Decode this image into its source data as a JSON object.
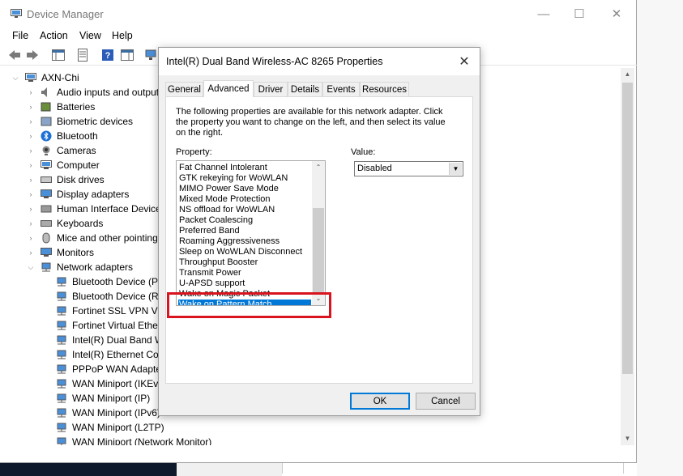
{
  "window": {
    "title": "Device Manager",
    "minimize": "—",
    "maximize": "☐",
    "close": "✕"
  },
  "menu": [
    "File",
    "Action",
    "View",
    "Help"
  ],
  "tree": {
    "root": "AXN-Chi",
    "categories": [
      {
        "label": "Audio inputs and outputs",
        "icon": "speaker-icon"
      },
      {
        "label": "Batteries",
        "icon": "battery-icon"
      },
      {
        "label": "Biometric devices",
        "icon": "biometric-icon"
      },
      {
        "label": "Bluetooth",
        "icon": "bluetooth-icon"
      },
      {
        "label": "Cameras",
        "icon": "camera-icon"
      },
      {
        "label": "Computer",
        "icon": "computer-icon"
      },
      {
        "label": "Disk drives",
        "icon": "disk-icon"
      },
      {
        "label": "Display adapters",
        "icon": "display-icon"
      },
      {
        "label": "Human Interface Devices",
        "icon": "hid-icon"
      },
      {
        "label": "Keyboards",
        "icon": "keyboard-icon"
      },
      {
        "label": "Mice and other pointing devices",
        "icon": "mouse-icon"
      },
      {
        "label": "Monitors",
        "icon": "monitor-icon"
      },
      {
        "label": "Network adapters",
        "icon": "network-icon"
      }
    ],
    "network_children": [
      "Bluetooth Device (Personal Area Network)",
      "Bluetooth Device (RFCOMM Protocol TDI)",
      "Fortinet SSL VPN Virtual Ethernet Adapter",
      "Fortinet Virtual Ethernet Adapter",
      "Intel(R) Dual Band Wireless-AC 8265",
      "Intel(R) Ethernet Connection",
      "PPPoP WAN Adapter",
      "WAN Miniport (IKEv2)",
      "WAN Miniport (IP)",
      "WAN Miniport (IPv6)",
      "WAN Miniport (L2TP)",
      "WAN Miniport (Network Monitor)"
    ]
  },
  "dialog": {
    "title": "Intel(R) Dual Band Wireless-AC 8265 Properties",
    "close": "✕",
    "tabs": [
      "General",
      "Advanced",
      "Driver",
      "Details",
      "Events",
      "Resources"
    ],
    "active_tab": "Advanced",
    "description": "The following properties are available for this network adapter. Click the property you want to change on the left, and then select its value on the right.",
    "property_label": "Property:",
    "value_label": "Value:",
    "properties": [
      "Fat Channel Intolerant",
      "GTK rekeying for WoWLAN",
      "MIMO Power Save Mode",
      "Mixed Mode Protection",
      "NS offload for WoWLAN",
      "Packet Coalescing",
      "Preferred Band",
      "Roaming Aggressiveness",
      "Sleep on WoWLAN Disconnect",
      "Throughput Booster",
      "Transmit Power",
      "U-APSD support",
      "Wake on Magic Packet",
      "Wake on Pattern Match"
    ],
    "selected_property": "Wake on Pattern Match",
    "value": "Disabled",
    "ok": "OK",
    "cancel": "Cancel"
  },
  "colors": {
    "selection": "#0078d7",
    "highlight": "#d9141e"
  }
}
